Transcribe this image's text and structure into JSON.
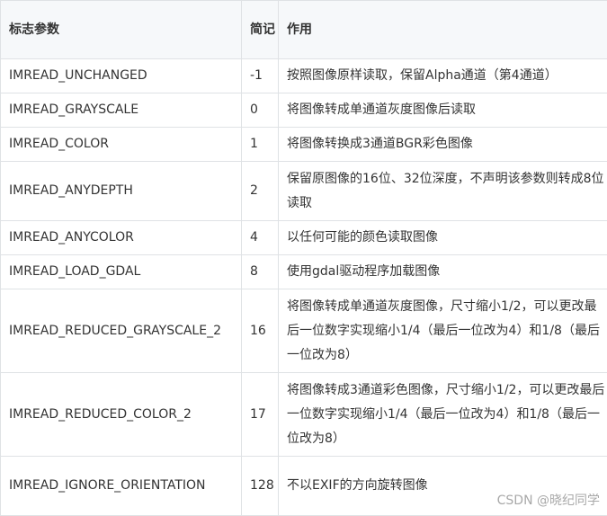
{
  "table": {
    "headers": [
      "标志参数",
      "简记",
      "作用"
    ],
    "rows": [
      {
        "flag": "IMREAD_UNCHANGED",
        "value": "-1",
        "desc": "按照图像原样读取，保留Alpha通道（第4通道）"
      },
      {
        "flag": "IMREAD_GRAYSCALE",
        "value": "0",
        "desc": "将图像转成单通道灰度图像后读取"
      },
      {
        "flag": "IMREAD_COLOR",
        "value": "1",
        "desc": "将图像转换成3通道BGR彩色图像"
      },
      {
        "flag": "IMREAD_ANYDEPTH",
        "value": "2",
        "desc": "保留原图像的16位、32位深度，不声明该参数则转成8位读取"
      },
      {
        "flag": "IMREAD_ANYCOLOR",
        "value": "4",
        "desc": "以任何可能的颜色读取图像"
      },
      {
        "flag": "IMREAD_LOAD_GDAL",
        "value": "8",
        "desc": "使用gdal驱动程序加载图像"
      },
      {
        "flag": "IMREAD_REDUCED_GRAYSCALE_2",
        "value": "16",
        "desc": "将图像转成单通道灰度图像，尺寸缩小1/2，可以更改最后一位数字实现缩小1/4（最后一位改为4）和1/8（最后一位改为8）"
      },
      {
        "flag": "IMREAD_REDUCED_COLOR_2",
        "value": "17",
        "desc": "将图像转成3通道彩色图像，尺寸缩小1/2，可以更改最后一位数字实现缩小1/4（最后一位改为4）和1/8（最后一位改为8）"
      },
      {
        "flag": "IMREAD_IGNORE_ORIENTATION",
        "value": "128",
        "desc": "不以EXIF的方向旋转图像"
      }
    ]
  },
  "watermark": "CSDN @晓纪同学"
}
